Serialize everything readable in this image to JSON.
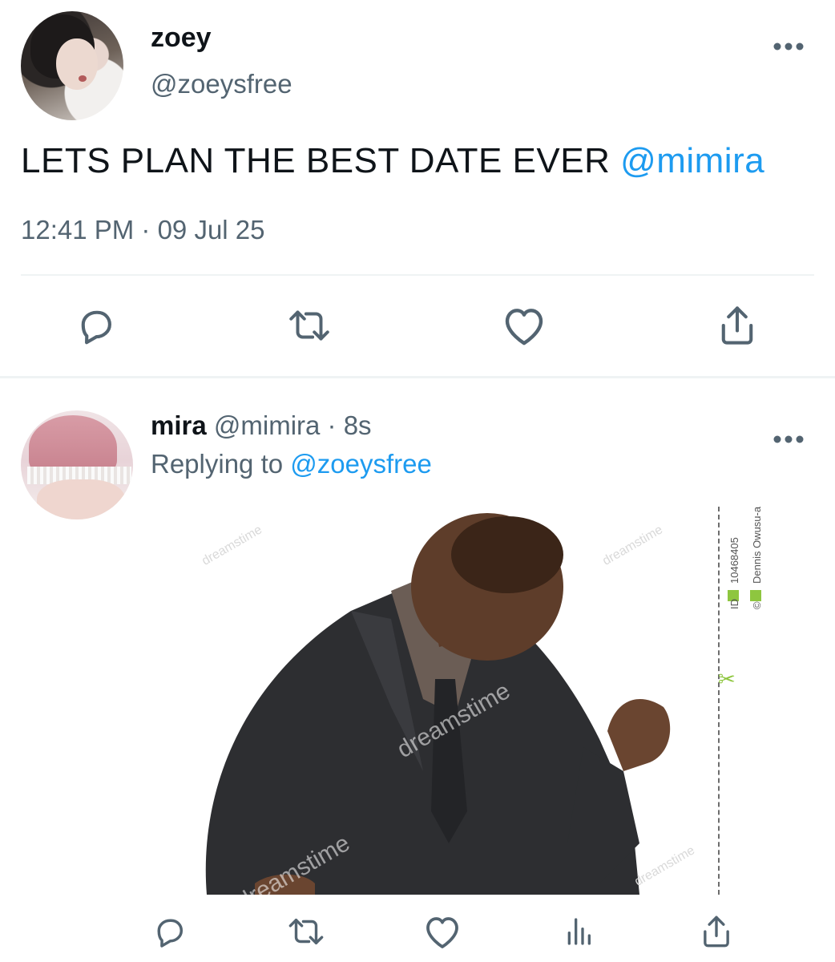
{
  "main_tweet": {
    "author": {
      "display_name": "zoey",
      "handle": "@zoeysfree"
    },
    "text": "LETS PLAN THE BEST DATE EVER ",
    "mention": "@mimira",
    "time": "12:41 PM",
    "separator": " · ",
    "date": "09 Jul 25",
    "more_icon": "ellipsis-icon",
    "actions": [
      "reply-icon",
      "retweet-icon",
      "like-icon",
      "share-icon"
    ]
  },
  "reply": {
    "author": {
      "display_name": "mira",
      "handle": "@mimira"
    },
    "age": " · 8s",
    "replying_prefix": "Replying to ",
    "replying_to": "@zoeysfree",
    "more_icon": "ellipsis-icon",
    "media": {
      "watermark_words": [
        "dreamstime",
        "dreamstime",
        "dreamstime",
        "dreamstime",
        "dreamstime"
      ],
      "stock_id": "10468405",
      "credit": "Dennis Owusu-an",
      "id_badge": "ID",
      "copyright_badge": "©"
    },
    "actions": [
      "reply-icon",
      "retweet-icon",
      "like-icon",
      "views-icon",
      "share-icon"
    ]
  },
  "colors": {
    "accent": "#1d9bf0",
    "secondary_text": "#536471",
    "icon": "#536471",
    "divider": "#eff3f4"
  }
}
